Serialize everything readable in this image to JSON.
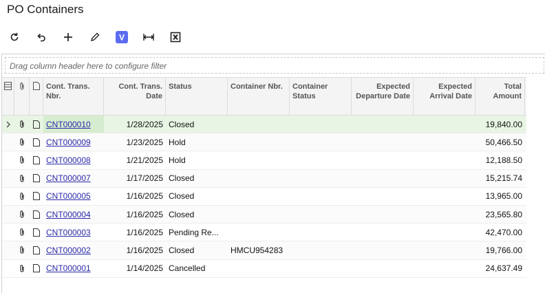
{
  "page": {
    "title": "PO Containers"
  },
  "toolbar": {
    "buttons": [
      {
        "name": "refresh-icon"
      },
      {
        "name": "undo-icon"
      },
      {
        "name": "add-icon"
      },
      {
        "name": "edit-icon"
      },
      {
        "name": "v-icon"
      },
      {
        "name": "fit-columns-icon"
      },
      {
        "name": "excel-export-icon"
      }
    ],
    "v_label": "V",
    "accent": "#5b6cf0"
  },
  "filter": {
    "placeholder": "Drag column header here to configure filter"
  },
  "grid": {
    "columns": {
      "nbr": "Cont. Trans. Nbr.",
      "date": "Cont. Trans. Date",
      "status": "Status",
      "container": "Container Nbr.",
      "container_status": "Container Status",
      "departure": "Expected Departure Date",
      "arrival": "Expected Arrival Date",
      "amount": "Total Amount"
    },
    "rows": [
      {
        "nbr": "CNT000010",
        "date": "1/28/2025",
        "status": "Closed",
        "container": "",
        "amount": "19,840.00"
      },
      {
        "nbr": "CNT000009",
        "date": "1/23/2025",
        "status": "Hold",
        "container": "",
        "amount": "50,466.50"
      },
      {
        "nbr": "CNT000008",
        "date": "1/21/2025",
        "status": "Hold",
        "container": "",
        "amount": "12,188.50"
      },
      {
        "nbr": "CNT000007",
        "date": "1/17/2025",
        "status": "Closed",
        "container": "",
        "amount": "15,215.74"
      },
      {
        "nbr": "CNT000005",
        "date": "1/16/2025",
        "status": "Closed",
        "container": "",
        "amount": "13,965.00"
      },
      {
        "nbr": "CNT000004",
        "date": "1/16/2025",
        "status": "Closed",
        "container": "",
        "amount": "23,565.80"
      },
      {
        "nbr": "CNT000003",
        "date": "1/16/2025",
        "status": "Pending Re...",
        "container": "",
        "amount": "42,470.00"
      },
      {
        "nbr": "CNT000002",
        "date": "1/16/2025",
        "status": "Closed",
        "container": "HMCU954283",
        "amount": "19,766.00"
      },
      {
        "nbr": "CNT000001",
        "date": "1/14/2025",
        "status": "Cancelled",
        "container": "",
        "amount": "24,637.49"
      }
    ]
  }
}
